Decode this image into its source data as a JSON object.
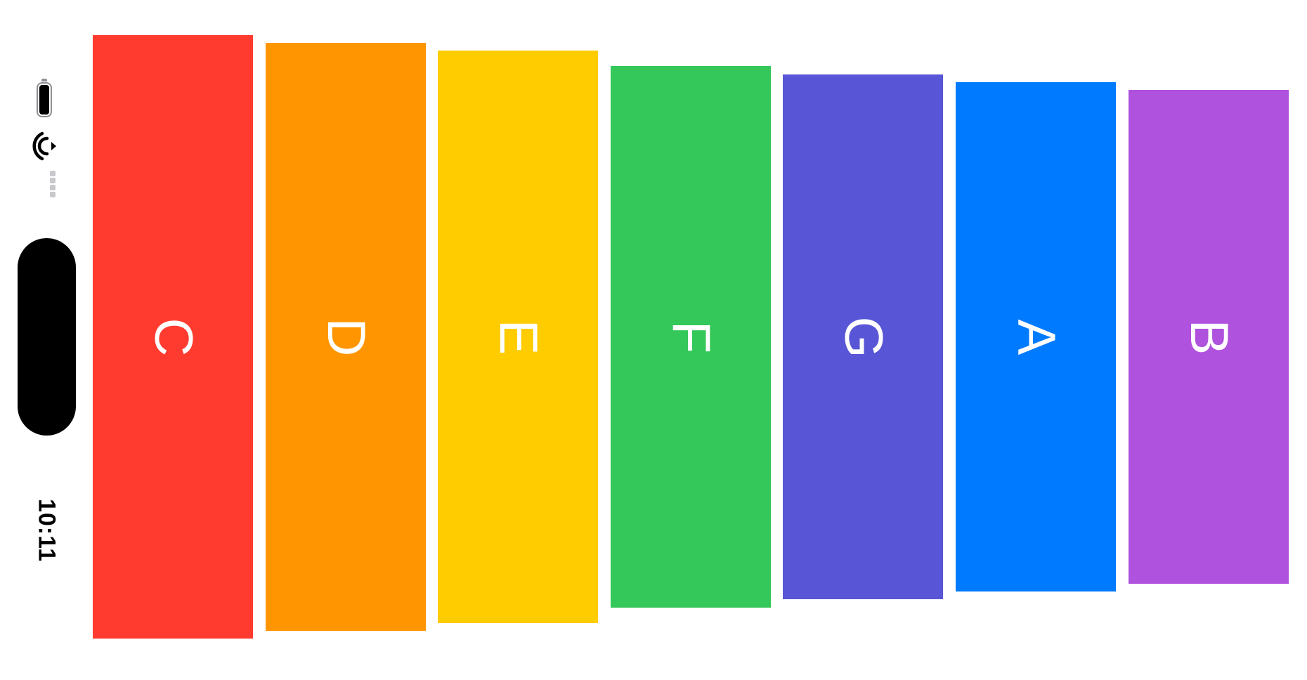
{
  "status_bar": {
    "time": "10:11",
    "battery_icon": "battery-icon",
    "wifi_icon": "wifi-icon",
    "signal_icon": "cellular-signal-icon"
  },
  "bars": [
    {
      "note": "C",
      "color": "#ff3b30"
    },
    {
      "note": "D",
      "color": "#ff9500"
    },
    {
      "note": "E",
      "color": "#ffcc00"
    },
    {
      "note": "F",
      "color": "#34c759"
    },
    {
      "note": "G",
      "color": "#5856d6"
    },
    {
      "note": "A",
      "color": "#007aff"
    },
    {
      "note": "B",
      "color": "#af52de"
    }
  ]
}
